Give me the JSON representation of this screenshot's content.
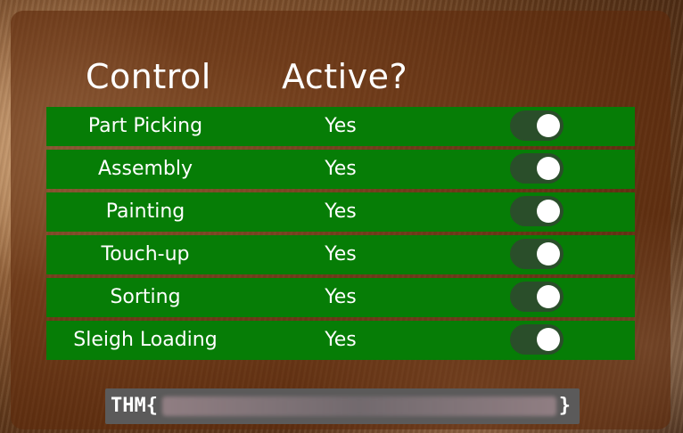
{
  "header": {
    "control_label": "Control",
    "active_label": "Active?"
  },
  "controls": [
    {
      "name": "Part Picking",
      "active": "Yes",
      "enabled": true
    },
    {
      "name": "Assembly",
      "active": "Yes",
      "enabled": true
    },
    {
      "name": "Painting",
      "active": "Yes",
      "enabled": true
    },
    {
      "name": "Touch-up",
      "active": "Yes",
      "enabled": true
    },
    {
      "name": "Sorting",
      "active": "Yes",
      "enabled": true
    },
    {
      "name": "Sleigh Loading",
      "active": "Yes",
      "enabled": true
    }
  ],
  "flag": {
    "prefix": "THM{",
    "suffix": "}"
  },
  "colors": {
    "row_bg": "#067d06",
    "toggle_on_bg": "#2a4e2a",
    "knob": "#ffffff",
    "panel_bg": "#5f2a0c",
    "flag_bg": "#5b5a5a"
  }
}
